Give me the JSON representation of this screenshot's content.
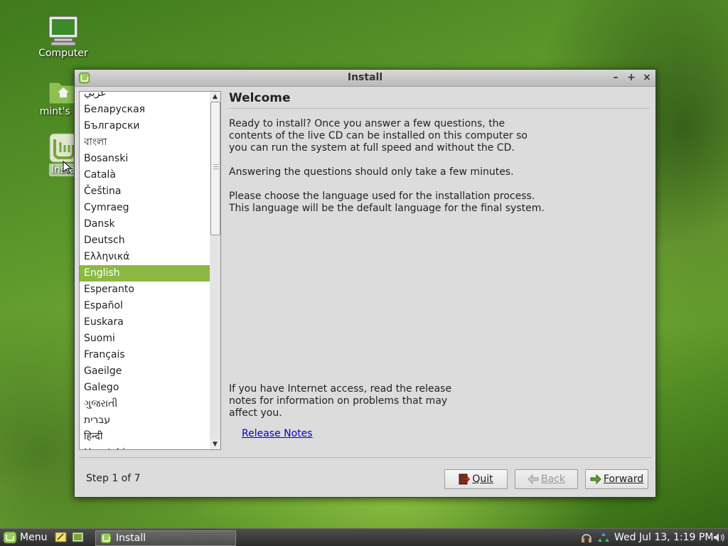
{
  "desktop": {
    "icons": [
      {
        "label": "Computer"
      },
      {
        "label": "mint's Ho"
      },
      {
        "label": "Insta"
      }
    ]
  },
  "window": {
    "title": "Install",
    "controls": {
      "minimize": "–",
      "maximize": "+",
      "close": "×"
    }
  },
  "languages": {
    "items": [
      "عربي",
      "Беларуская",
      "Български",
      "বাংলা",
      "Bosanski",
      "Català",
      "Čeština",
      "Cymraeg",
      "Dansk",
      "Deutsch",
      "Ελληνικά",
      "English",
      "Esperanto",
      "Español",
      "Euskara",
      "Suomi",
      "Français",
      "Gaeilge",
      "Galego",
      "ગુજરાતી",
      "עברית",
      "हिन्दी",
      "Hrvatski"
    ],
    "selected": "English"
  },
  "welcome": {
    "heading": "Welcome",
    "para1_line1": "Ready to install? Once you answer a few questions, the",
    "para1_line2": "contents of the live CD can be installed on this computer so",
    "para1_line3": "you can run the system at full speed and without the CD.",
    "para2": "Answering the questions should only take a few minutes.",
    "para3_line1": "Please choose the language used for the installation process.",
    "para3_line2": "This language will be the default language for the final system.",
    "notes_line1": "If you have Internet access, read the release",
    "notes_line2": "notes for information on problems that may",
    "notes_line3": "affect you.",
    "release_link": "Release Notes"
  },
  "footer": {
    "step": "Step 1 of 7",
    "quit": "Quit",
    "back": "Back",
    "forward": "Forward"
  },
  "taskbar": {
    "menu": "Menu",
    "task": "Install",
    "clock": "Wed Jul 13,  1:19 PM"
  }
}
